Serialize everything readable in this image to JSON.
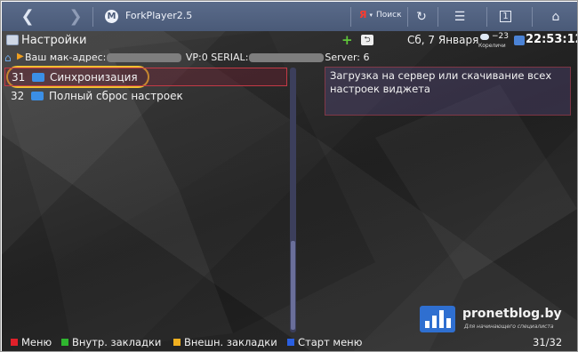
{
  "browser": {
    "back_icon": "chevron-left-icon",
    "forward_icon": "chevron-right-icon",
    "app_icon": "forkplayer-logo-icon",
    "app_logo_text": "M",
    "tab_title": "ForkPlayer2.5",
    "search": {
      "engine_glyph": "Я",
      "label": "Поиск"
    },
    "reload_icon": "reload-icon",
    "menu_icon": "menu-icon",
    "tabs_count": "1",
    "home_icon": "home-icon"
  },
  "header": {
    "title": "Настройки",
    "add_icon": "plus-icon",
    "back_icon": "back-icon",
    "back_glyph": "⮌",
    "date": "Сб, 7 Января",
    "weather": {
      "temp": "−23",
      "city": "Кореличи"
    },
    "time": "22:53:12"
  },
  "address": {
    "prefix": "Ваш мак-адрес:",
    "vp": " VP:0 SERIAL:",
    "server": "Server: 6"
  },
  "list": {
    "items": [
      {
        "num": "31",
        "label": "Синхронизация",
        "selected": true
      },
      {
        "num": "32",
        "label": "Полный сброс настроек",
        "selected": false
      }
    ]
  },
  "description": "Загрузка на сервер или скачивание всех настроек виджета",
  "watermark": {
    "text": "pronetblog.by",
    "sub": "Для начинающего специалиста"
  },
  "footer": {
    "items": [
      {
        "label": "Меню",
        "color": "#e0202a"
      },
      {
        "label": "Внутр. закладки",
        "color": "#2fb62f"
      },
      {
        "label": "Внешн. закладки",
        "color": "#f0b020"
      },
      {
        "label": "Старт меню",
        "color": "#2a5fe0"
      }
    ],
    "count": "31/32"
  },
  "colors": {
    "browserbar": "#4f6080",
    "selection_border": "#c33a46",
    "highlight_circle": "#f0c030",
    "folder": "#3b8fe6"
  }
}
